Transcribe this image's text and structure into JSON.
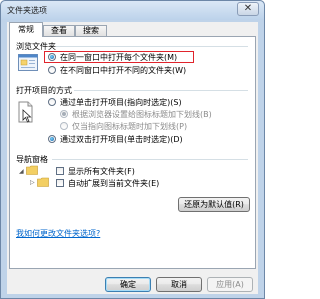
{
  "window": {
    "title": "文件夹选项",
    "close_glyph": "✕"
  },
  "tabs": [
    {
      "label": "常规"
    },
    {
      "label": "查看"
    },
    {
      "label": "搜索"
    }
  ],
  "browse_group": {
    "title": "浏览文件夹",
    "options": [
      {
        "label": "在同一窗口中打开每个文件夹(M)",
        "checked": true
      },
      {
        "label": "在不同窗口中打开不同的文件夹(W)",
        "checked": false
      }
    ]
  },
  "open_group": {
    "title": "打开项目的方式",
    "options": [
      {
        "label": "通过单击打开项目(指向时选定)(S)",
        "checked": false
      },
      {
        "label": "根据浏览器设置给图标标题加下划线(B)",
        "checked": true,
        "disabled": true
      },
      {
        "label": "仅当指向图标标题时加下划线(P)",
        "checked": false,
        "disabled": true
      },
      {
        "label": "通过双击打开项目(单击时选定)(D)",
        "checked": true
      }
    ]
  },
  "nav_group": {
    "title": "导航窗格",
    "options": [
      {
        "label": "显示所有文件夹(F)",
        "checked": false
      },
      {
        "label": "自动扩展到当前文件夹(E)",
        "checked": false
      }
    ]
  },
  "restore_button": "还原为默认值(R)",
  "help_link": "我如何更改文件夹选项?",
  "buttons": {
    "ok": "确定",
    "cancel": "取消",
    "apply": "应用(A)"
  },
  "colors": {
    "highlight": "#e0242c",
    "link": "#0066cc"
  }
}
